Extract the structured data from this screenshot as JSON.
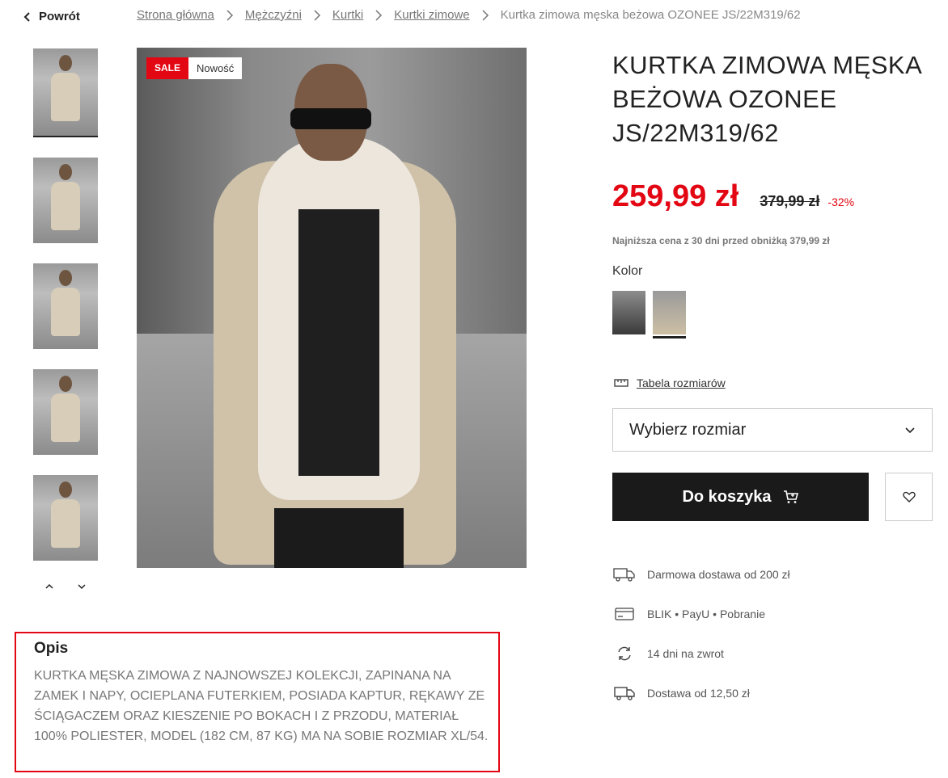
{
  "nav": {
    "back_label": "Powrót"
  },
  "breadcrumb": {
    "items": [
      "Strona główna",
      "Mężczyźni",
      "Kurtki",
      "Kurtki zimowe"
    ],
    "current": "Kurtka zimowa męska beżowa OZONEE JS/22M319/62"
  },
  "gallery": {
    "badges": {
      "sale": "SALE",
      "new": "Nowość"
    },
    "thumbnail_count": 5
  },
  "product": {
    "title": "KURTKA ZIMOWA MĘSKA BEŻOWA OZONEE JS/22M319/62",
    "price_now": "259,99 zł",
    "price_old": "379,99 zł",
    "discount": "-32%",
    "lowest_price_note": "Najniższa cena z 30 dni przed obniżką 379,99 zł",
    "color_label": "Kolor",
    "colors": [
      "dark",
      "beige"
    ],
    "selected_color": "beige",
    "size_table_label": "Tabela rozmiarów",
    "size_select_placeholder": "Wybierz rozmiar",
    "cart_button": "Do koszyka"
  },
  "info": [
    {
      "icon": "free-delivery-icon",
      "text": "Darmowa dostawa od 200 zł"
    },
    {
      "icon": "card-icon",
      "text": "BLIK • PayU • Pobranie"
    },
    {
      "icon": "return-icon",
      "text": "14 dni na zwrot"
    },
    {
      "icon": "truck-icon",
      "text": "Dostawa od 12,50 zł"
    }
  ],
  "description": {
    "heading": "Opis",
    "text": "KURTKA MĘSKA ZIMOWA Z NAJNOWSZEJ KOLEKCJI, ZAPINANA NA ZAMEK I NAPY, OCIEPLANA FUTERKIEM, POSIADA KAPTUR, RĘKAWY ZE ŚCIĄGACZEM ORAZ KIESZENIE PO BOKACH I Z PRZODU, MATERIAŁ 100% POLIESTER, MODEL (182 CM, 87 KG) MA NA SOBIE ROZMIAR XL/54."
  },
  "colors": {
    "accent_red": "#e30613",
    "button_dark": "#1a1a1a",
    "highlight_border": "#e30613"
  }
}
